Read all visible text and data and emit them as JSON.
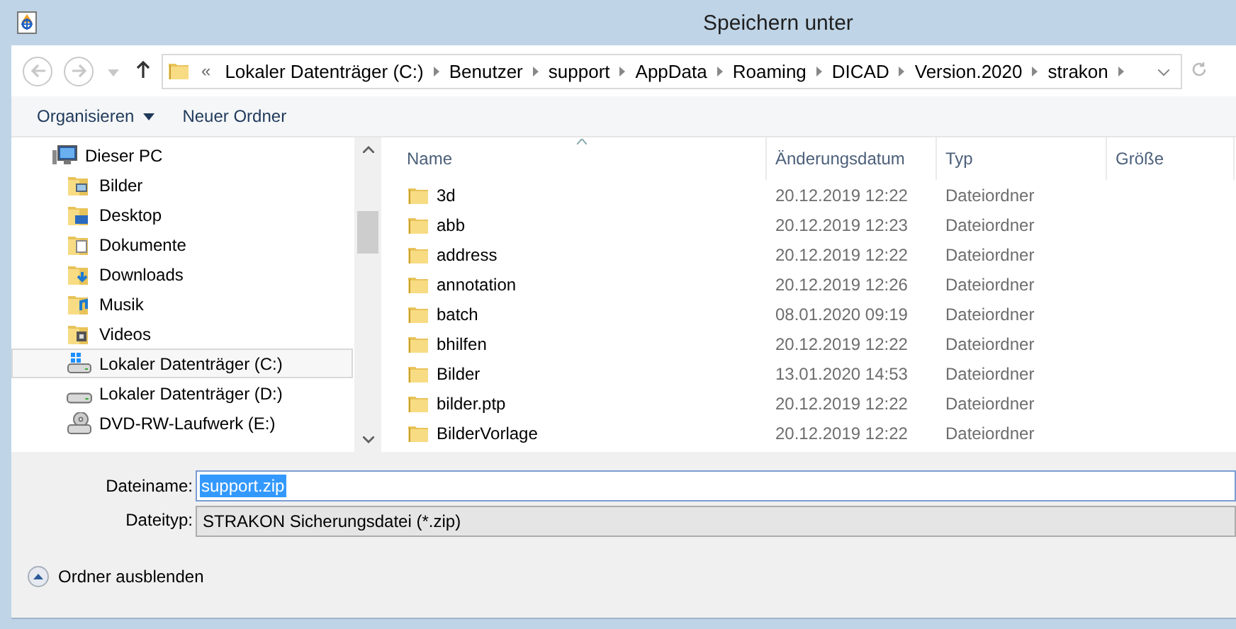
{
  "window": {
    "title": "Speichern unter"
  },
  "navigation": {
    "back_disabled": true,
    "forward_disabled": true,
    "overflow_chevron": "«",
    "breadcrumbs": [
      "Lokaler Datenträger (C:)",
      "Benutzer",
      "support",
      "AppData",
      "Roaming",
      "DICAD",
      "Version.2020",
      "strakon"
    ]
  },
  "toolbar": [
    {
      "label": "Organisieren",
      "kind": "menu"
    },
    {
      "label": "Neuer Ordner",
      "kind": "button"
    }
  ],
  "sidebar": {
    "items": [
      {
        "label": "Dieser PC",
        "kind": "pc",
        "selected": false,
        "children": [
          {
            "label": "Bilder",
            "kind": "pictures",
            "selected": false
          },
          {
            "label": "Desktop",
            "kind": "desktop",
            "selected": false
          },
          {
            "label": "Dokumente",
            "kind": "documents",
            "selected": false
          },
          {
            "label": "Downloads",
            "kind": "downloads",
            "selected": false
          },
          {
            "label": "Musik",
            "kind": "music",
            "selected": false
          },
          {
            "label": "Videos",
            "kind": "videos",
            "selected": false
          },
          {
            "label": "Lokaler Datenträger (C:)",
            "kind": "system-drive",
            "selected": true
          },
          {
            "label": "Lokaler Datenträger (D:)",
            "kind": "drive",
            "selected": false
          },
          {
            "label": "DVD-RW-Laufwerk (E:)",
            "kind": "dvd",
            "selected": false
          }
        ]
      }
    ]
  },
  "table": {
    "columns": [
      "Name",
      "Änderungsdatum",
      "Typ",
      "Größe"
    ],
    "rows": [
      [
        "3d",
        "20.12.2019 12:22",
        "Dateiordner"
      ],
      [
        "abb",
        "20.12.2019 12:23",
        "Dateiordner"
      ],
      [
        "address",
        "20.12.2019 12:22",
        "Dateiordner"
      ],
      [
        "annotation",
        "20.12.2019 12:26",
        "Dateiordner"
      ],
      [
        "batch",
        "08.01.2020 09:19",
        "Dateiordner"
      ],
      [
        "bhilfen",
        "20.12.2019 12:22",
        "Dateiordner"
      ],
      [
        "Bilder",
        "13.01.2020 14:53",
        "Dateiordner"
      ],
      [
        "bilder.ptp",
        "20.12.2019 12:22",
        "Dateiordner"
      ],
      [
        "BilderVorlage",
        "20.12.2019 12:22",
        "Dateiordner"
      ]
    ]
  },
  "form": {
    "filename_label": "Dateiname:",
    "filename": {
      "value": "support.zip",
      "text_selected": true
    },
    "filetype_label": "Dateityp:",
    "filetype": "STRAKON Sicherungsdatei (*.zip)"
  },
  "footer": {
    "toggle_label": "Ordner ausblenden",
    "expanded": true
  }
}
